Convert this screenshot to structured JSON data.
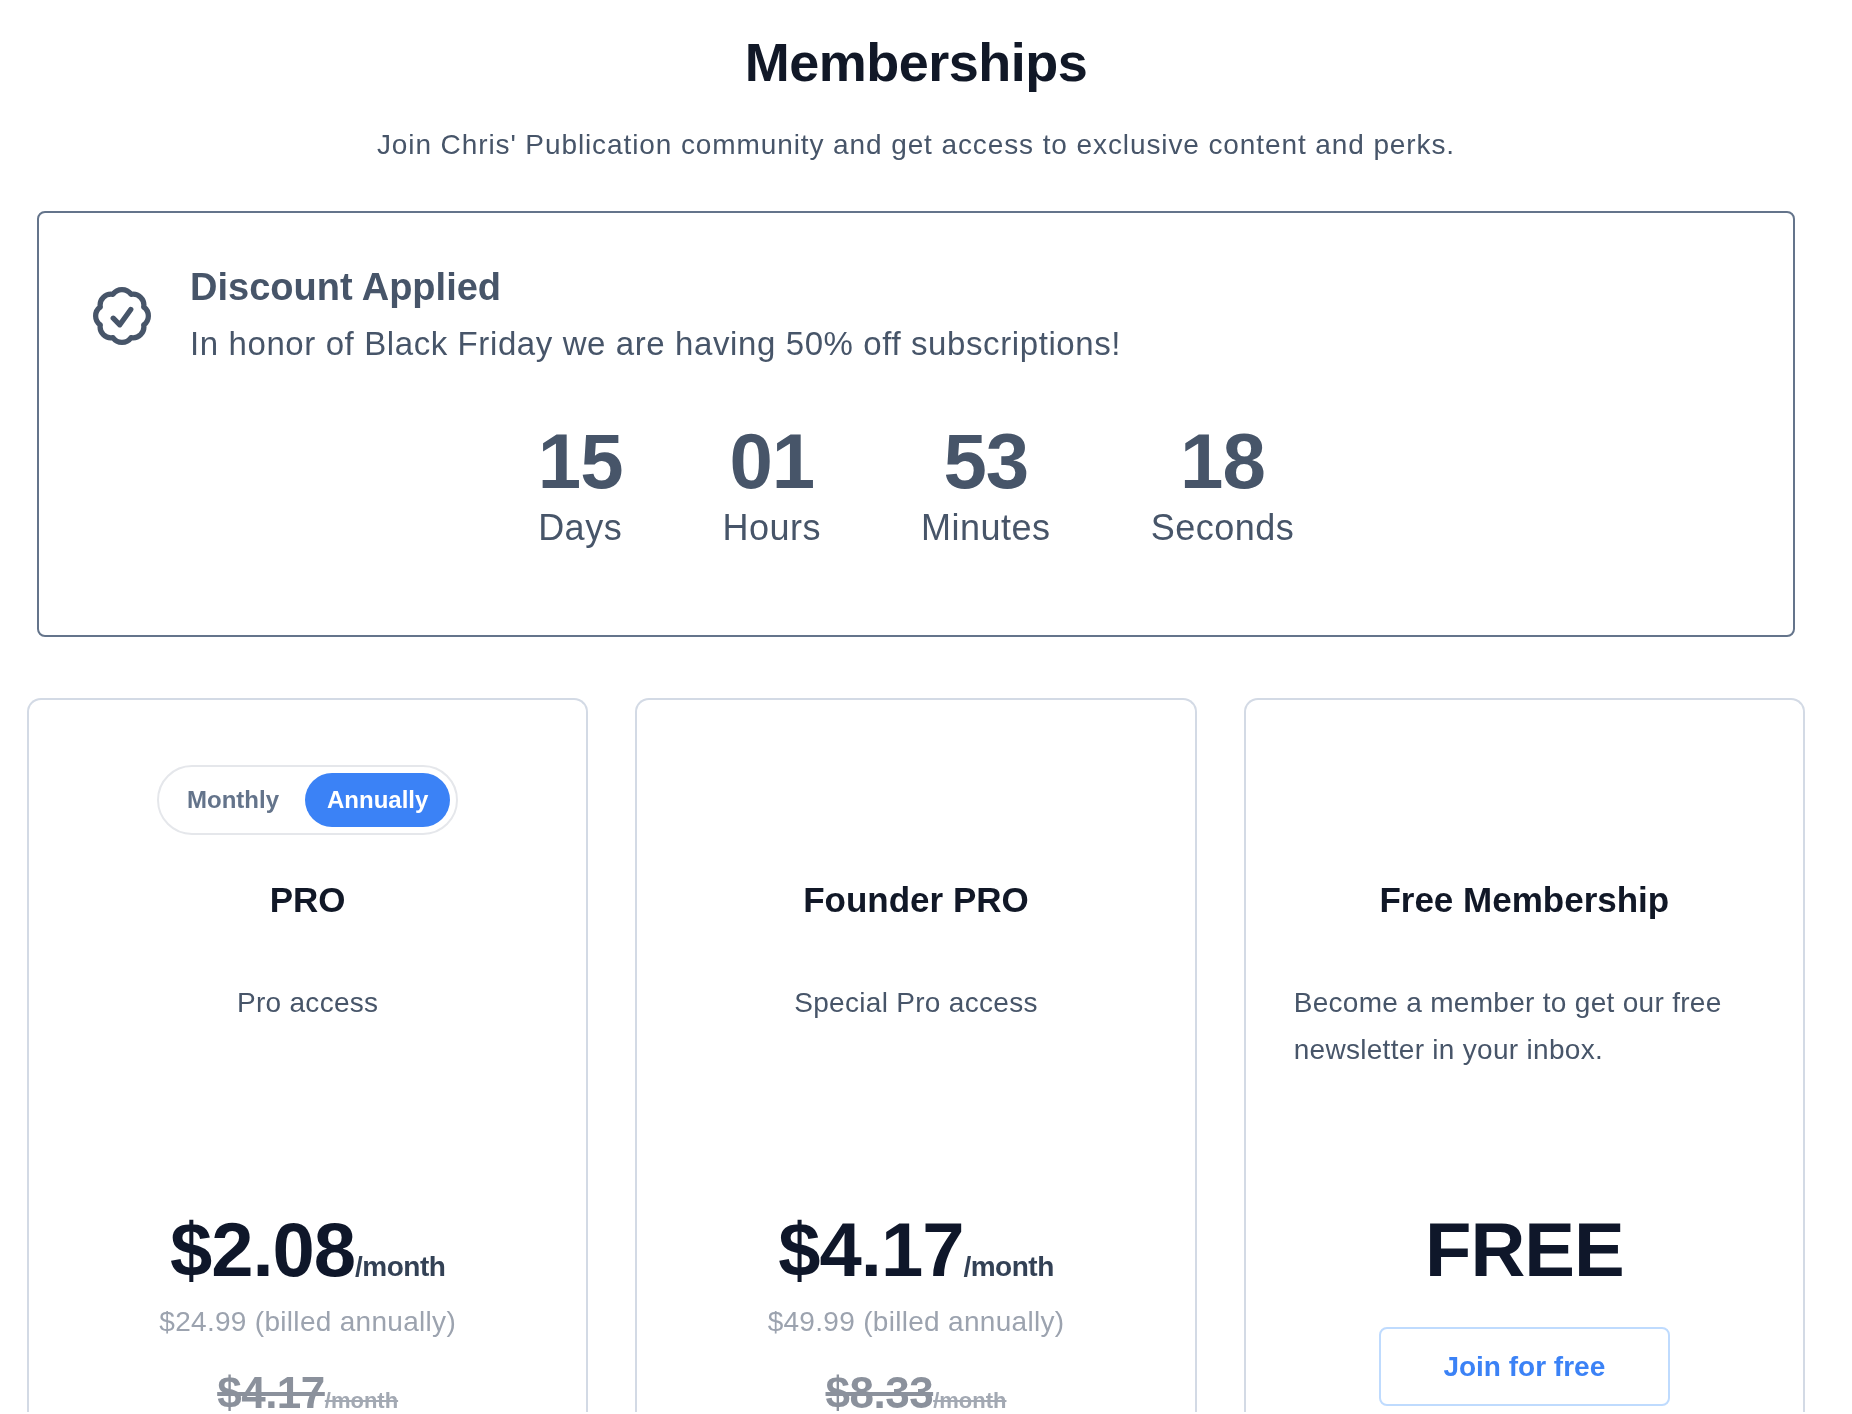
{
  "header": {
    "title": "Memberships",
    "subtitle": "Join Chris' Publication community and get access to exclusive content and perks."
  },
  "discount": {
    "title": "Discount Applied",
    "message": "In honor of Black Friday we are having 50% off subscriptions!",
    "countdown": [
      {
        "value": "15",
        "unit": "Days"
      },
      {
        "value": "01",
        "unit": "Hours"
      },
      {
        "value": "53",
        "unit": "Minutes"
      },
      {
        "value": "18",
        "unit": "Seconds"
      }
    ]
  },
  "plans": [
    {
      "kind": "paid",
      "billing_toggle": [
        {
          "label": "Monthly",
          "selected": false
        },
        {
          "label": "Annually",
          "selected": true
        }
      ],
      "name": "PRO",
      "description": "Pro access",
      "price": "$2.08",
      "period": "/month",
      "billed": "$24.99 (billed annually)",
      "original_price": "$4.17",
      "original_period": "/month"
    },
    {
      "kind": "paid",
      "name": "Founder PRO",
      "description": "Special Pro access",
      "price": "$4.17",
      "period": "/month",
      "billed": "$49.99 (billed annually)",
      "original_price": "$8.33",
      "original_period": "/month"
    },
    {
      "kind": "free",
      "name": "Free Membership",
      "description": "Become a member to get our free newsletter in your inbox.",
      "price": "FREE",
      "button": "Join for free"
    }
  ]
}
